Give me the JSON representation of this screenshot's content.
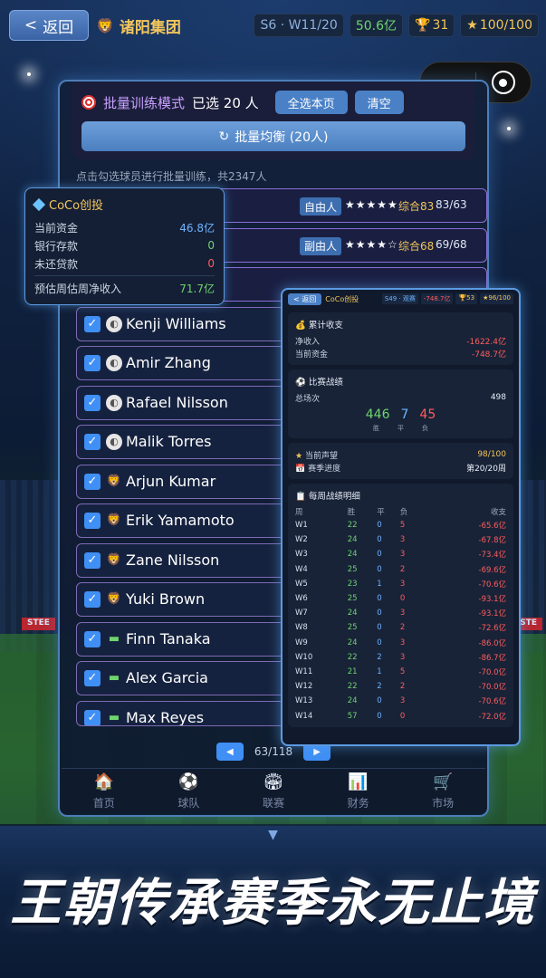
{
  "header": {
    "back_label": "返回",
    "club_name": "诸阳集团",
    "season": "S6 · W11/20",
    "money": "50.6亿",
    "trophies": "31",
    "reputation": "100/100"
  },
  "batch": {
    "title": "批量训练模式",
    "selected": "已选 20 人",
    "select_all_label": "全选本页",
    "clear_label": "清空",
    "balance_label": "批量均衡 (20人)",
    "hint": "点击勾选球员进行批量训练，共2347人"
  },
  "finance_popup": {
    "title": "CoCo创投",
    "rows": [
      {
        "label": "当前资金",
        "value": "46.8亿"
      },
      {
        "label": "银行存款",
        "value": "0"
      },
      {
        "label": "未还贷款",
        "value": "0"
      },
      {
        "label": "预估周估周净收入",
        "value": "71.7亿"
      }
    ]
  },
  "players": [
    {
      "name": "",
      "tag": "自由人",
      "stars": "★★★★★",
      "overall": "综合83",
      "potential": "83/63"
    },
    {
      "name": "",
      "tag": "副由人",
      "stars": "★★★★☆",
      "overall": "综合68",
      "potential": "69/68"
    },
    {
      "name": "Kenji Williams"
    },
    {
      "name": "Amir Zhang"
    },
    {
      "name": "Rafael Nilsson"
    },
    {
      "name": "Malik Torres"
    },
    {
      "name": "Arjun Kumar"
    },
    {
      "name": "Erik Yamamoto"
    },
    {
      "name": "Zane Nilsson"
    },
    {
      "name": "Yuki Brown"
    },
    {
      "name": "Finn Tanaka"
    },
    {
      "name": "Alex Garcia"
    },
    {
      "name": "Max Reyes"
    }
  ],
  "pager": {
    "text": "63/118",
    "prev": "◀",
    "next": "▶"
  },
  "nav": [
    {
      "label": "首页",
      "icon": "home-icon"
    },
    {
      "label": "球队",
      "icon": "ball-icon"
    },
    {
      "label": "联赛",
      "icon": "stadium-icon"
    },
    {
      "label": "财务",
      "icon": "chart-icon"
    },
    {
      "label": "市场",
      "icon": "cart-icon"
    }
  ],
  "overlay": {
    "back": "< 返回",
    "club": "CoCo创投",
    "stats": [
      "S49 · 观赛",
      "-748.7亿",
      "🏆53",
      "★96/100"
    ],
    "income": {
      "title": "累计收支",
      "rows": [
        {
          "label": "净收入",
          "value": "-1622.4亿"
        },
        {
          "label": "当前资金",
          "value": "-748.7亿"
        }
      ]
    },
    "record": {
      "title": "比赛战绩",
      "total_label": "总场次",
      "total": "498",
      "wins": "446",
      "draws": "7",
      "losses": "45",
      "w_label": "胜",
      "d_label": "平",
      "l_label": "负"
    },
    "rep": {
      "rows": [
        {
          "label": "当前声望",
          "value": "98/100"
        },
        {
          "label": "赛季进度",
          "value": "第20/20周"
        }
      ]
    },
    "weekly": {
      "title": "每周战绩明细",
      "headers": [
        "周",
        "胜",
        "平",
        "负",
        "",
        "收支"
      ],
      "rows": [
        [
          "W1",
          "22",
          "0",
          "5",
          "-65.6亿"
        ],
        [
          "W2",
          "24",
          "0",
          "3",
          "-67.8亿"
        ],
        [
          "W3",
          "24",
          "0",
          "3",
          "-73.4亿"
        ],
        [
          "W4",
          "25",
          "0",
          "2",
          "-69.6亿"
        ],
        [
          "W5",
          "23",
          "1",
          "3",
          "-70.6亿"
        ],
        [
          "W6",
          "25",
          "0",
          "0",
          "-93.1亿"
        ],
        [
          "W7",
          "24",
          "0",
          "3",
          "-93.1亿"
        ],
        [
          "W8",
          "25",
          "0",
          "2",
          "-72.6亿"
        ],
        [
          "W9",
          "24",
          "0",
          "3",
          "-86.0亿"
        ],
        [
          "W10",
          "22",
          "2",
          "3",
          "-86.7亿"
        ],
        [
          "W11",
          "21",
          "1",
          "5",
          "-70.0亿"
        ],
        [
          "W12",
          "22",
          "2",
          "2",
          "-70.0亿"
        ],
        [
          "W13",
          "24",
          "0",
          "3",
          "-70.6亿"
        ],
        [
          "W14",
          "57",
          "0",
          "0",
          "-72.0亿"
        ]
      ]
    }
  },
  "banner": {
    "slogan": "王朝传承赛季永无止境"
  },
  "colors": {
    "accent": "#3f8ff5",
    "gold": "#f3c65c",
    "win": "#6fd46f",
    "loss": "#ff5d5d"
  }
}
